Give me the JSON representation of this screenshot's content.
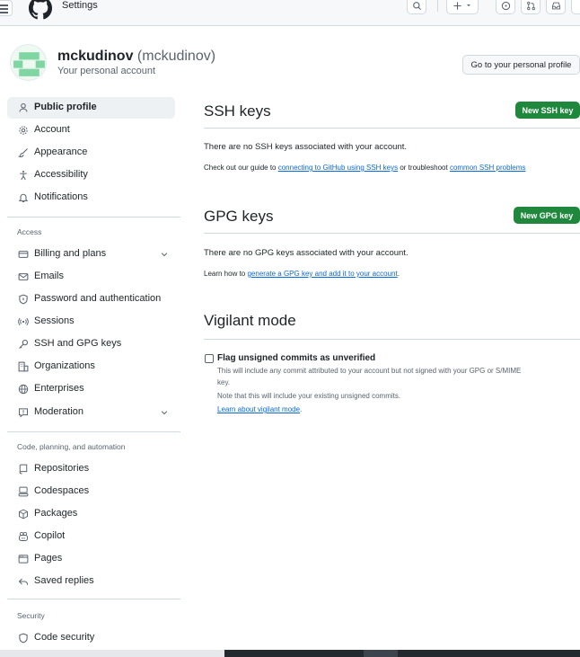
{
  "header": {
    "title": "Settings",
    "icons": [
      "menu-icon",
      "github-logo",
      "search-icon",
      "plus-icon",
      "caret-down-icon",
      "issue-icon",
      "pull-request-icon",
      "inbox-icon"
    ]
  },
  "profile": {
    "username": "mckudinov",
    "handle": "(mckudinov)",
    "subtitle": "Your personal account",
    "profile_button": "Go to your personal profile"
  },
  "sidebar": {
    "items_top": [
      {
        "label": "Public profile",
        "icon": "person-icon",
        "active": true
      },
      {
        "label": "Account",
        "icon": "gear-icon"
      },
      {
        "label": "Appearance",
        "icon": "paintbrush-icon"
      },
      {
        "label": "Accessibility",
        "icon": "accessibility-icon"
      },
      {
        "label": "Notifications",
        "icon": "bell-icon"
      }
    ],
    "access": {
      "heading": "Access",
      "items": [
        {
          "label": "Billing and plans",
          "icon": "credit-card-icon",
          "expandable": true
        },
        {
          "label": "Emails",
          "icon": "mail-icon"
        },
        {
          "label": "Password and authentication",
          "icon": "shield-lock-icon"
        },
        {
          "label": "Sessions",
          "icon": "broadcast-icon"
        },
        {
          "label": "SSH and GPG keys",
          "icon": "key-icon"
        },
        {
          "label": "Organizations",
          "icon": "organization-icon"
        },
        {
          "label": "Enterprises",
          "icon": "globe-icon"
        },
        {
          "label": "Moderation",
          "icon": "report-icon",
          "expandable": true
        }
      ]
    },
    "code": {
      "heading": "Code, planning, and automation",
      "items": [
        {
          "label": "Repositories",
          "icon": "repo-icon"
        },
        {
          "label": "Codespaces",
          "icon": "codespaces-icon"
        },
        {
          "label": "Packages",
          "icon": "package-icon"
        },
        {
          "label": "Copilot",
          "icon": "copilot-icon"
        },
        {
          "label": "Pages",
          "icon": "browser-icon"
        },
        {
          "label": "Saved replies",
          "icon": "reply-icon"
        }
      ]
    },
    "security": {
      "heading": "Security",
      "items": [
        {
          "label": "Code security",
          "icon": "shield-icon"
        }
      ]
    }
  },
  "ssh": {
    "title": "SSH keys",
    "button": "New SSH key",
    "empty": "There are no SSH keys associated with your account.",
    "guide_prefix": "Check out our guide to ",
    "guide_link": "connecting to GitHub using SSH keys",
    "guide_mid": " or troubleshoot ",
    "guide_link2": "common SSH problems"
  },
  "gpg": {
    "title": "GPG keys",
    "button": "New GPG key",
    "empty": "There are no GPG keys associated with your account.",
    "learn_prefix": "Learn how to ",
    "learn_link": "generate a GPG key and add it to your account",
    "learn_suffix": "."
  },
  "vigilant": {
    "title": "Vigilant mode",
    "checkbox_label": "Flag unsigned commits as unverified",
    "checked": false,
    "desc_line1": "This will include any commit attributed to your account but not signed with your GPG or S/MIME",
    "desc_line2": "key.",
    "desc_line3": "Note that this will include your existing unsigned commits.",
    "learn_link": "Learn about vigilant mode",
    "learn_suffix": "."
  },
  "colors": {
    "accent": "#0969da",
    "primary_button": "#1f883d",
    "border": "#d1d9e0",
    "muted_text": "#59636e"
  }
}
